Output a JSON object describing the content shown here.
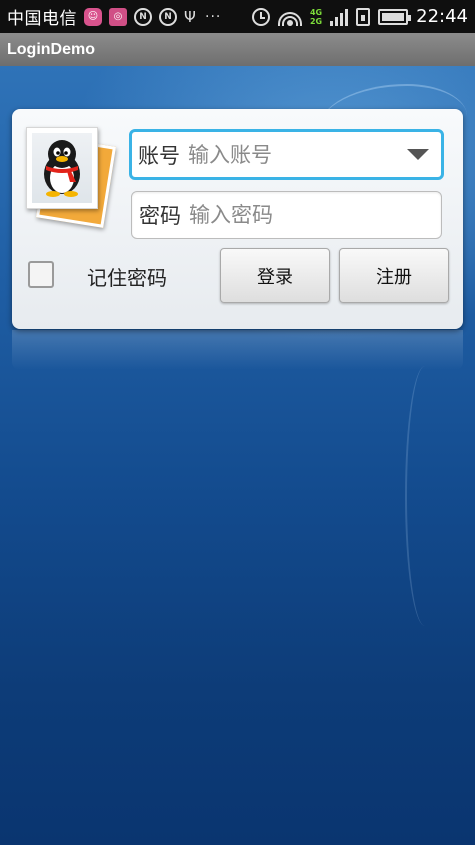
{
  "status_bar": {
    "carrier": "中国电信",
    "network_type_top": "4G",
    "network_type_bottom": "2G",
    "time": "22:44",
    "icons": [
      "pink-app-icon",
      "pink-app-icon-2",
      "n-icon",
      "n-icon-2",
      "usb-icon",
      "more-icon",
      "alarm-clock-icon",
      "wifi-icon",
      "signal-icon",
      "sim-icon",
      "battery-icon"
    ]
  },
  "title_bar": {
    "title": "LoginDemo"
  },
  "login": {
    "avatar_icon": "qq-penguin-icon",
    "account": {
      "label": "账号",
      "placeholder": "输入账号",
      "value": ""
    },
    "password": {
      "label": "密码",
      "placeholder": "输入密码",
      "value": ""
    },
    "remember": {
      "label": "记住密码",
      "checked": false
    },
    "login_button": "登录",
    "register_button": "注册"
  },
  "colors": {
    "focus_border": "#3ab3e6",
    "title_bar": "#7d7d7d",
    "status_bar": "#0f0f0f",
    "network_label": "#7ddc3a"
  }
}
